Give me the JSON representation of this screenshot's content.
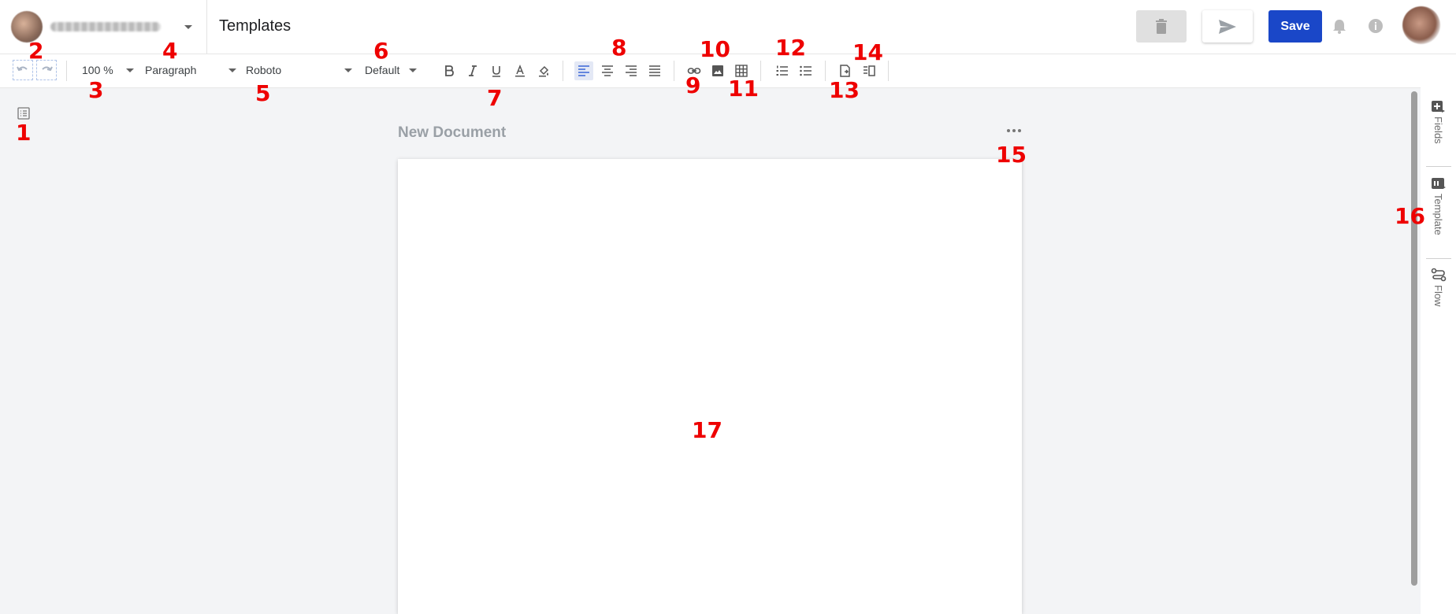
{
  "header": {
    "title": "Templates",
    "save_label": "Save",
    "org_icon": "avatar"
  },
  "toolbar": {
    "zoom": "100 %",
    "block_style": "Paragraph",
    "font": "Roboto",
    "size": "Default"
  },
  "document": {
    "title": "New Document"
  },
  "right_sidebar": {
    "tabs": [
      "Fields",
      "Template",
      "Flow"
    ]
  },
  "annotations": [
    "1",
    "2",
    "3",
    "4",
    "5",
    "6",
    "7",
    "8",
    "9",
    "10",
    "11",
    "12",
    "13",
    "14",
    "15",
    "16",
    "17"
  ],
  "colors": {
    "accent": "#1a47c8",
    "annotation": "#ee0000",
    "align_selected": "#3b66d6"
  }
}
